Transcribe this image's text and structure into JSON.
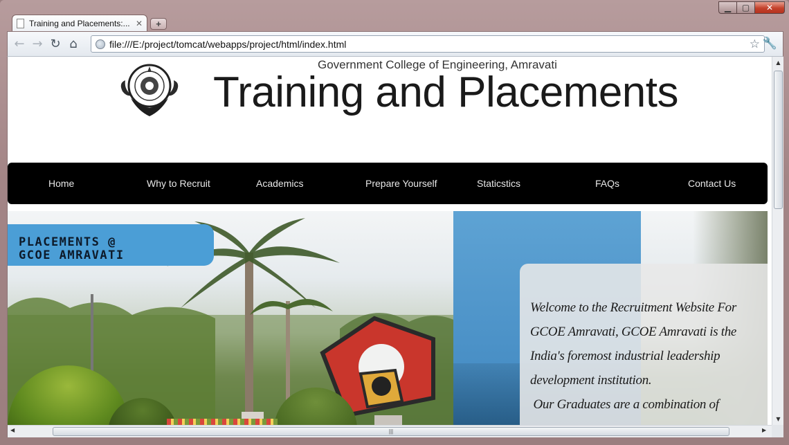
{
  "browser": {
    "tab_title": "Training and Placements:...",
    "tab_close": "✕",
    "new_tab": "+",
    "url": "file:///E:/project/tomcat/webapps/project/html/index.html",
    "window_controls": {
      "minimize": "▁",
      "maximize": "▢",
      "close": "✕"
    }
  },
  "header": {
    "college": "Government College of Engineering, Amravati",
    "title": "Training and Placements",
    "logo_icon": "college-emblem-icon"
  },
  "nav": {
    "items": [
      "Home",
      "Why to Recruit",
      "Academics",
      "Prepare Yourself",
      "Staticstics",
      "FAQs",
      "Contact Us"
    ]
  },
  "banner": {
    "placements_line1": "PLACEMENTS @",
    "placements_line2": "GCOE AMRAVATI",
    "welcome_text": "Welcome to the Recruitment Website For GCOE Amravati, GCOE Amravati is the India's foremost industrial leadership development institution.",
    "graduates_text": "Our Graduates are a combination of"
  },
  "colors": {
    "navbar": "#000000",
    "banner_blue": "#4b9ed6",
    "welcome_box": "#e8e8e8"
  }
}
